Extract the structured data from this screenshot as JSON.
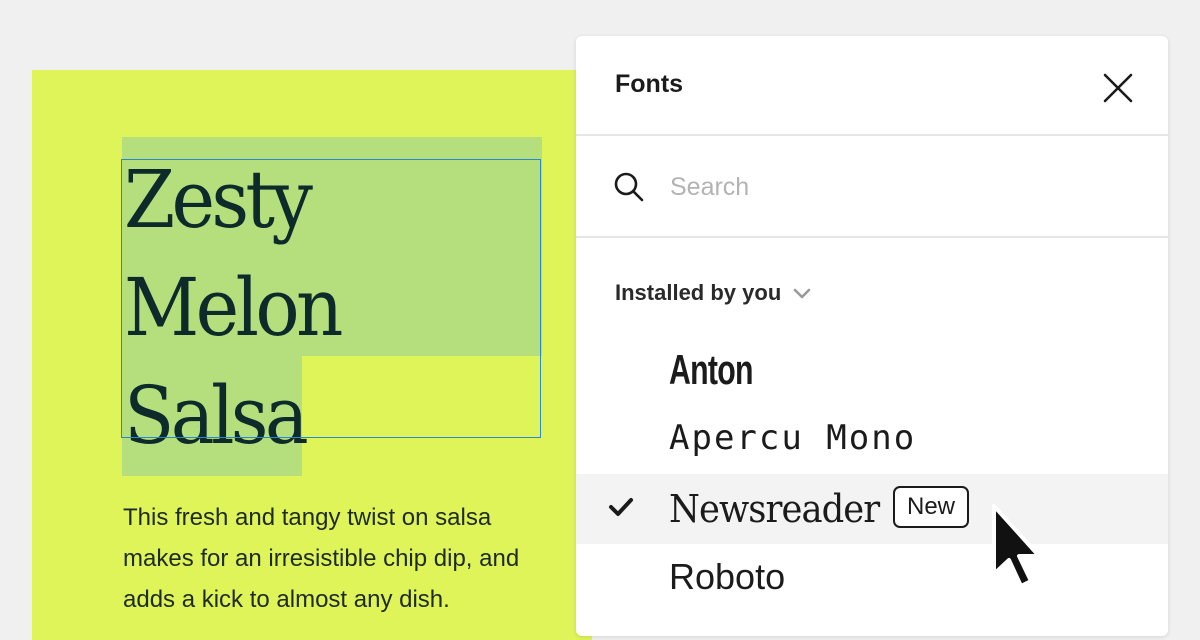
{
  "canvas": {
    "headline_lines": [
      "Zesty",
      "Melon",
      "Salsa"
    ],
    "body_text": "This fresh and tangy twist on salsa makes for an irresistible chip dip, and adds a kick to almost any dish."
  },
  "panel": {
    "title": "Fonts",
    "search": {
      "placeholder": "Search",
      "value": ""
    },
    "section_label": "Installed by you",
    "fonts": [
      {
        "name": "Anton",
        "selected": false
      },
      {
        "name": "Apercu Mono",
        "selected": false
      },
      {
        "name": "Newsreader",
        "selected": true,
        "badge": "New"
      },
      {
        "name": "Roboto",
        "selected": false
      }
    ]
  },
  "icons": {
    "close": "close-icon",
    "search": "search-icon",
    "section_toggle": "chevron-down-icon",
    "selected": "checkmark-icon",
    "pointer": "mouse-cursor-icon"
  },
  "colors": {
    "canvas_card": "#def458",
    "text_highlight": "#b4df7c",
    "selection_outline": "#2a8ac9",
    "panel_bg": "#ffffff",
    "hover_row": "#f3f3f3"
  }
}
